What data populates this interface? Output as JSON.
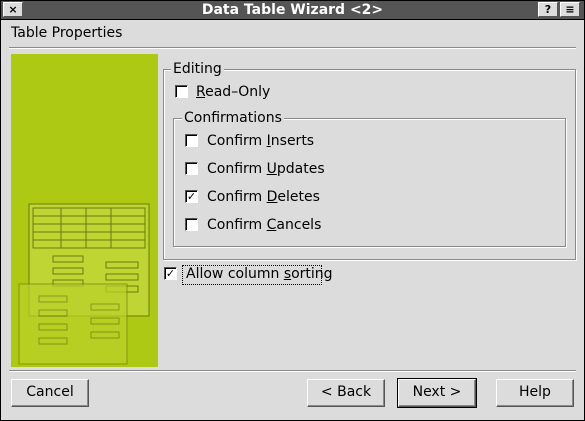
{
  "window": {
    "title": "Data Table Wizard <2>",
    "close_icon": "×",
    "help_icon": "?",
    "menu_icon": "≡"
  },
  "header": {
    "title": "Table Properties"
  },
  "editing": {
    "legend": "Editing",
    "read_only": {
      "label_pre": "",
      "mnemonic": "R",
      "label_post": "ead–Only",
      "checked": false
    },
    "confirmations": {
      "legend": "Confirmations",
      "items": [
        {
          "label_pre": "Confirm ",
          "mnemonic": "I",
          "label_post": "nserts",
          "checked": false
        },
        {
          "label_pre": "Confirm ",
          "mnemonic": "U",
          "label_post": "pdates",
          "checked": false
        },
        {
          "label_pre": "Confirm ",
          "mnemonic": "D",
          "label_post": "eletes",
          "checked": true
        },
        {
          "label_pre": "Confirm ",
          "mnemonic": "C",
          "label_post": "ancels",
          "checked": false
        }
      ]
    }
  },
  "allow_sorting": {
    "label_pre": "Allow column ",
    "mnemonic": "s",
    "label_post": "orting",
    "checked": true
  },
  "buttons": {
    "cancel": "Cancel",
    "back": "< Back",
    "next": "Next >",
    "help": "Help"
  },
  "colors": {
    "sidebar": "#aec914",
    "titlebar": "#555555",
    "background": "#dcdcdc"
  }
}
